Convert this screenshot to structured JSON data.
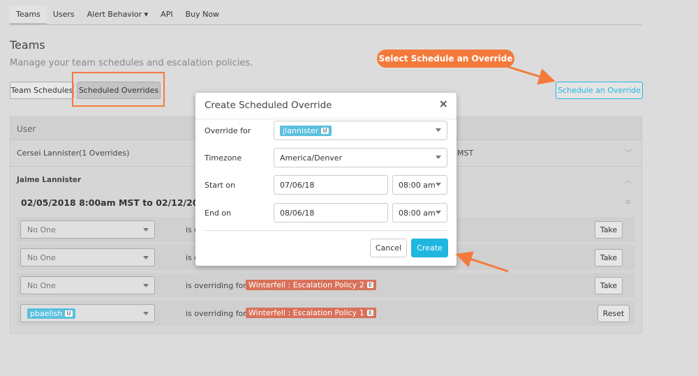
{
  "nav": [
    "Teams",
    "Users",
    "Alert Behavior ▾",
    "API",
    "Buy Now"
  ],
  "page": {
    "title": "Teams",
    "subtitle": "Manage your team schedules and escalation policies.",
    "tab_schedules": "Team Schedules",
    "tab_overrides": "Scheduled Overrides",
    "schedule_button": "Schedule an Override"
  },
  "table": {
    "header": "User",
    "row1": {
      "name": "Cersei Lannister",
      "count": "(1 Overrides)",
      "tail": "MST"
    },
    "row2": {
      "name": "Jaime Lannister",
      "range": "02/05/2018 8:00am MST to 02/12/2018 5:00"
    },
    "overrides": [
      {
        "who": "No One",
        "text": "is o",
        "policy": "",
        "action": "Take"
      },
      {
        "who": "No One",
        "text": "is o",
        "policy": "",
        "action": "Take"
      },
      {
        "who": "No One",
        "text": "is overriding for",
        "policy": "Winterfell : Escalation Policy 2",
        "action": "Take"
      },
      {
        "who": "pbaelish",
        "text": "is overriding for",
        "policy": "Winterfell : Escalation Policy 1",
        "action": "Reset"
      }
    ]
  },
  "modal": {
    "title": "Create Scheduled Override",
    "close": "×",
    "override_for_label": "Override for",
    "override_for_value": "jlannister",
    "timezone_label": "Timezone",
    "timezone_value": "America/Denver",
    "start_label": "Start on",
    "start_date": "07/06/18",
    "start_time": "08:00 am",
    "end_label": "End on",
    "end_date": "08/06/18",
    "end_time": "08:00 am",
    "cancel": "Cancel",
    "create": "Create"
  },
  "badge_user": "U",
  "badge_policy": "E",
  "annotation": "Select Schedule an Override",
  "colors": {
    "accent": "#1fb6e0",
    "annotation": "#f47a3c",
    "policy": "#d9715a"
  }
}
